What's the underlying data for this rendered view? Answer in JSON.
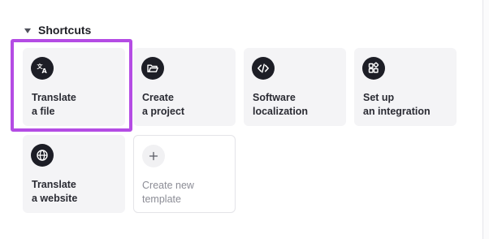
{
  "section": {
    "title": "Shortcuts"
  },
  "tiles": [
    {
      "label": "Translate\na file",
      "icon": "translate-icon"
    },
    {
      "label": "Create\na project",
      "icon": "folder-open-icon"
    },
    {
      "label": "Software\nlocalization",
      "icon": "code-icon"
    },
    {
      "label": "Set up\nan integration",
      "icon": "apps-icon"
    },
    {
      "label": "Translate\na website",
      "icon": "globe-icon"
    },
    {
      "label": "Create new\ntemplate",
      "icon": "plus-icon"
    }
  ],
  "colors": {
    "highlight": "#b44ce4",
    "icon_bg": "#1d1e26",
    "tile_bg": "#f4f4f6"
  }
}
